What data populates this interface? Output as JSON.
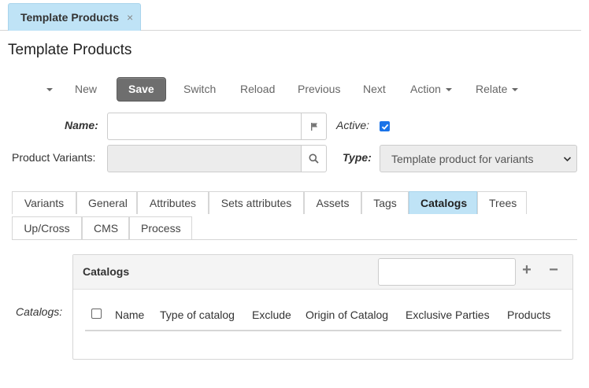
{
  "doc_tab": {
    "label": "Template Products",
    "close": "×"
  },
  "page_title": "Template Products",
  "toolbar": {
    "new": "New",
    "save": "Save",
    "switch": "Switch",
    "reload": "Reload",
    "previous": "Previous",
    "next": "Next",
    "action": "Action",
    "relate": "Relate"
  },
  "form": {
    "name_label": "Name:",
    "name_value": "",
    "active_label": "Active:",
    "active_checked": true,
    "variants_label": "Product Variants:",
    "variants_value": "",
    "type_label": "Type:",
    "type_value": "Template product for variants"
  },
  "tabs": [
    {
      "label": "Variants",
      "active": false
    },
    {
      "label": "General",
      "active": false
    },
    {
      "label": "Attributes",
      "active": false
    },
    {
      "label": "Sets attributes",
      "active": false
    },
    {
      "label": "Assets",
      "active": false
    },
    {
      "label": "Tags",
      "active": false
    },
    {
      "label": "Catalogs",
      "active": true
    },
    {
      "label": "Trees",
      "active": false
    },
    {
      "label": "Up/Cross",
      "active": false
    },
    {
      "label": "CMS",
      "active": false
    },
    {
      "label": "Process",
      "active": false
    }
  ],
  "catalogs": {
    "field_label": "Catalogs:",
    "panel_title": "Catalogs",
    "search_value": "",
    "add": "+",
    "remove": "−",
    "columns": [
      "Name",
      "Type of catalog",
      "Exclude",
      "Origin of Catalog",
      "Exclusive Parties",
      "Products"
    ]
  },
  "colors": {
    "accent_tab": "#bfe3f6",
    "save_button": "#6e6e6e",
    "checkbox": "#1a73e8"
  }
}
